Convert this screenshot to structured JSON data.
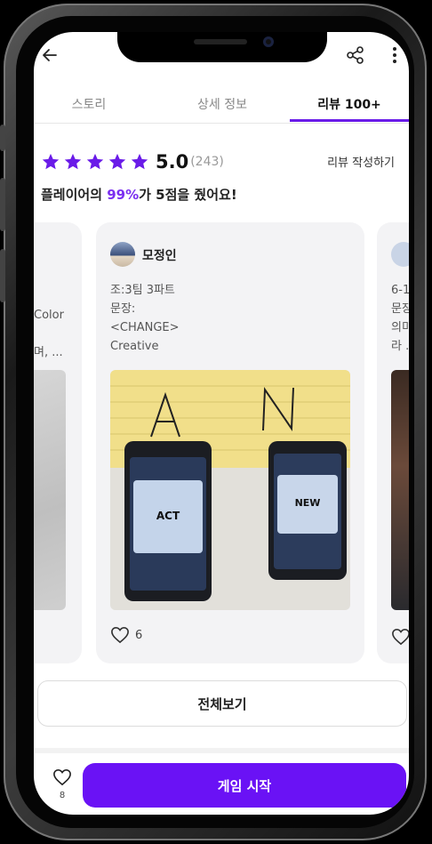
{
  "tabs": [
    {
      "label": "스토리"
    },
    {
      "label": "상세 정보"
    },
    {
      "label": "리뷰 100+"
    }
  ],
  "rating": {
    "score": "5.0",
    "count": "(243)",
    "write_review": "리뷰 작성하기"
  },
  "summary": {
    "prefix": "플레이어의 ",
    "highlight": "99%",
    "suffix": "가 5점을 줬어요!"
  },
  "reviews": [
    {
      "author": "",
      "lines": [
        "Color",
        "며, ..."
      ]
    },
    {
      "author": "모정인",
      "lines": [
        "조:3팀 3파트",
        "문장:",
        "<CHANGE>",
        "Creative"
      ],
      "likes": "6",
      "photo_labels": {
        "phone1": "ACT",
        "phone2": "NEW"
      }
    },
    {
      "author": "",
      "lines": [
        "6-1",
        "문장",
        "의미",
        "라 ..."
      ]
    }
  ],
  "see_all": "전체보기",
  "bottom": {
    "like_count": "8",
    "start_button": "게임 시작"
  },
  "colors": {
    "accent": "#6a12f5",
    "star": "#6a1be8",
    "highlight": "#7b2ff0"
  }
}
